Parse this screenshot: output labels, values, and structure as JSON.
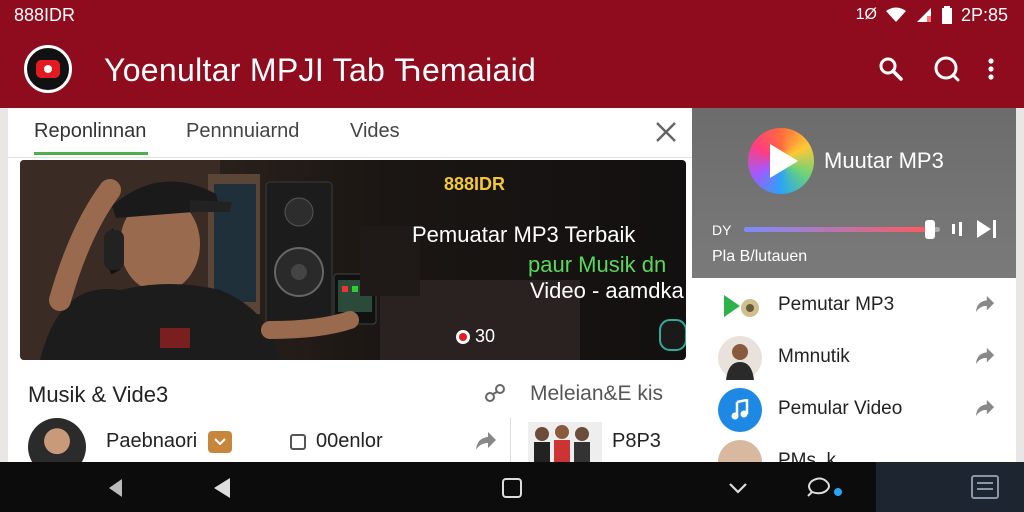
{
  "status": {
    "carrier": "888IDR",
    "time": "2P:85",
    "indicator": "1Ø"
  },
  "app": {
    "title": "Yoenultar MPJI Tab Ћemaiaid"
  },
  "tabs": [
    {
      "label": "Reponlinnan",
      "active": true
    },
    {
      "label": "Pennnuiarnd",
      "active": false
    },
    {
      "label": "Vides",
      "active": false
    }
  ],
  "hero": {
    "brand": "888IDR",
    "line1": "Pemuatar MP3 Terbaik",
    "line2": "paur Musik dn",
    "line3": "Video - aamdka l",
    "views": "30"
  },
  "section": {
    "title": "Musik & Vide3",
    "second_title": "Meleian&E kis",
    "rows": [
      {
        "label": "Paebnaori"
      },
      {
        "label": "00enlor"
      },
      {
        "label": "P8P3"
      }
    ]
  },
  "player": {
    "title": "Muutar MP3",
    "time_label": "DY",
    "progress": 0.95,
    "subtitle": "Pla B/lutauen"
  },
  "right_list": [
    {
      "label": "Pemutar MP3",
      "icon": "play-icon"
    },
    {
      "label": "Mmnutik",
      "icon": "artist-avatar"
    },
    {
      "label": "Pemular Video",
      "icon": "music-note-icon"
    },
    {
      "label": "PMs..k",
      "icon": "avatar"
    }
  ],
  "colors": {
    "brand": "#8e0c1e",
    "accent_green": "#4caf50",
    "note_blue": "#1e88e5"
  }
}
